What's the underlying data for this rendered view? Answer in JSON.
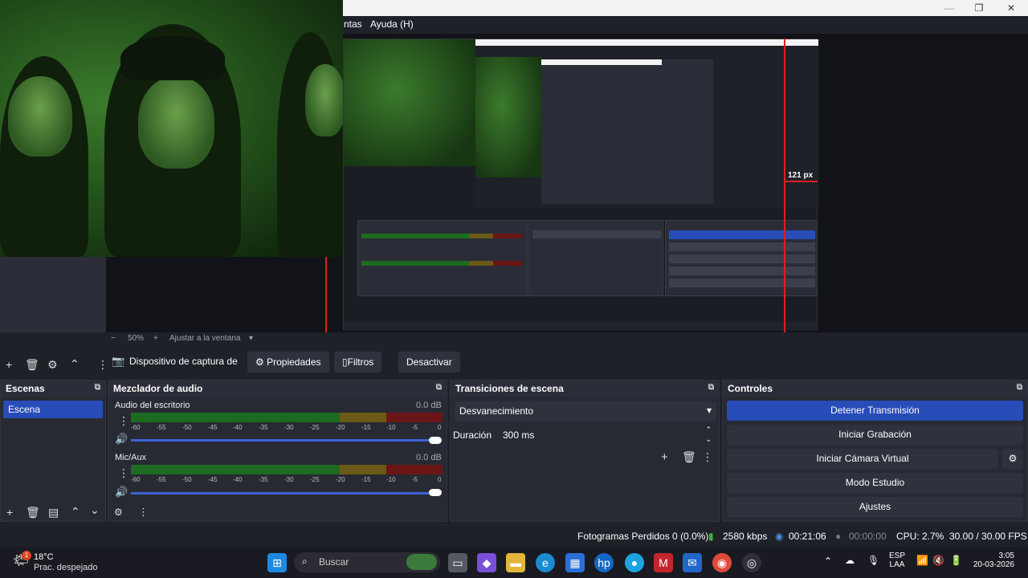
{
  "window": {
    "minimize": "—",
    "maximize": "❐",
    "close": "✕"
  },
  "menu": {
    "item_partial": "ntas",
    "help": "Ayuda (H)"
  },
  "preview": {
    "measure_label": "121 px",
    "zoom": "50%",
    "fit": "Ajustar a la ventana"
  },
  "source_bar": {
    "source_name": "Dispositivo de captura de v",
    "properties": "Propiedades",
    "filters": "Filtros",
    "deactivate": "Desactivar"
  },
  "scenes": {
    "title": "Escenas",
    "items": [
      "Escena"
    ]
  },
  "mixer": {
    "title": "Mezclador de audio",
    "channels": [
      {
        "name": "Audio del escritorio",
        "db": "0.0 dB"
      },
      {
        "name": "Mic/Aux",
        "db": "0.0 dB"
      }
    ],
    "ticks": [
      "-60",
      "-55",
      "-50",
      "-45",
      "-40",
      "-35",
      "-30",
      "-25",
      "-20",
      "-15",
      "-10",
      "-5",
      "0"
    ]
  },
  "transitions": {
    "title": "Transiciones de escena",
    "selected": "Desvanecimiento",
    "duration_label": "Duración",
    "duration_value": "300 ms"
  },
  "controls": {
    "title": "Controles",
    "stop_stream": "Detener Transmisión",
    "start_recording": "Iniciar Grabación",
    "start_virtual_cam": "Iniciar Cámara Virtual",
    "studio_mode": "Modo Estudio",
    "settings": "Ajustes"
  },
  "status": {
    "dropped_frames": "Fotogramas Perdidos 0 (0.0%)",
    "bitrate": "2580 kbps",
    "stream_time": "00:21:06",
    "rec_time": "00:00:00",
    "cpu": "CPU: 2.7%",
    "fps": "30.00 / 30.00 FPS"
  },
  "taskbar": {
    "weather_temp": "18°C",
    "weather_desc": "Prac. despejado",
    "weather_badge": "1",
    "search_placeholder": "Buscar",
    "lang_1": "ESP",
    "lang_2": "LAA",
    "time": "3:05",
    "date": "20-03-2026"
  },
  "colors": {
    "accent": "#284cb8",
    "bg": "#1f2129",
    "panel": "#272a33"
  }
}
